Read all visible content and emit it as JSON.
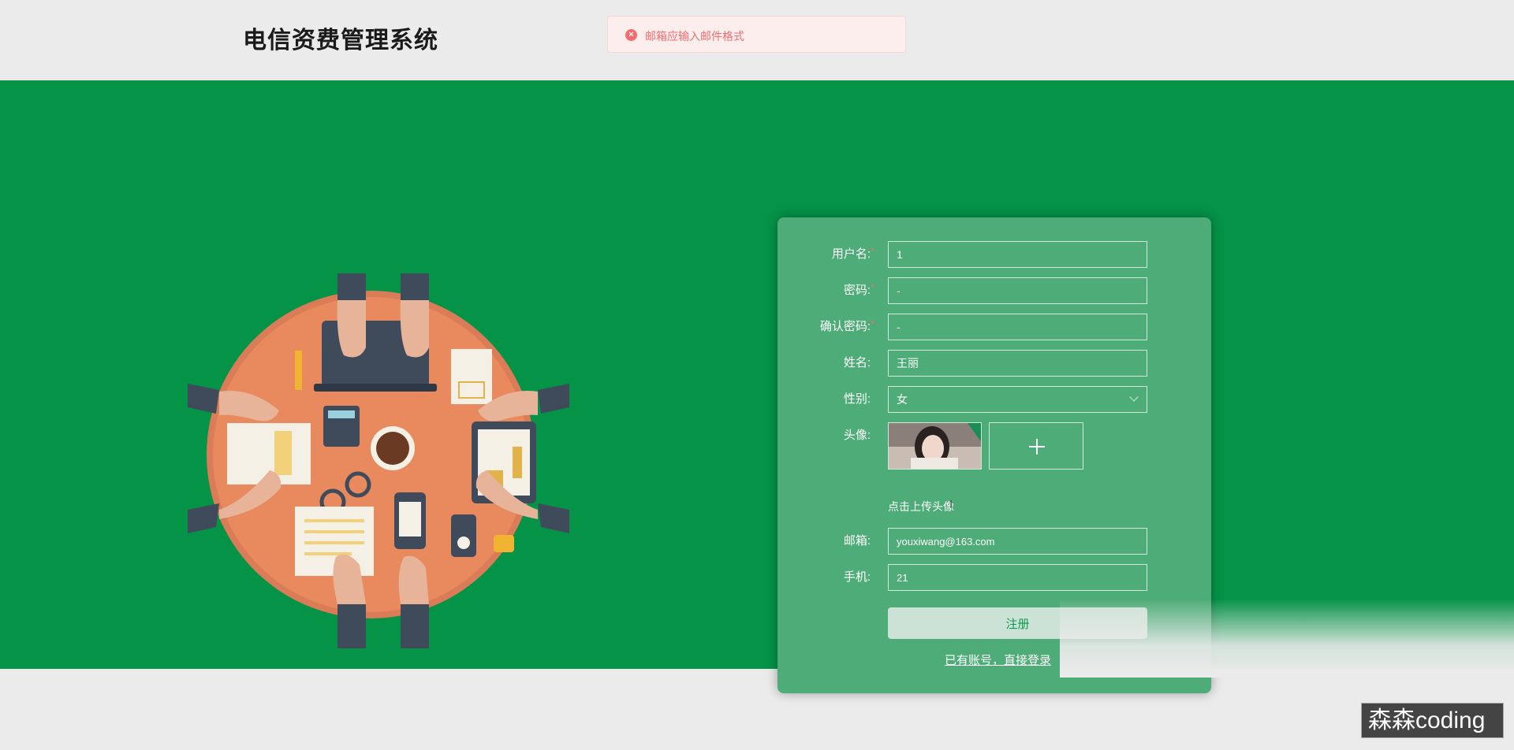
{
  "header": {
    "title": "电信资费管理系统"
  },
  "toast": {
    "icon": "error-circle-icon",
    "message": "邮箱应输入邮件格式",
    "color": "#f56c6c"
  },
  "colors": {
    "hero_green": "#059347",
    "card_green": "#4dac77",
    "button_bg": "#cde2d6",
    "button_text": "#0b9a4f"
  },
  "form": {
    "username": {
      "label": "用户名:",
      "value": "1",
      "required": true
    },
    "password": {
      "label": "密码:",
      "value": "-",
      "required": true
    },
    "confirm_password": {
      "label": "确认密码:",
      "value": "-",
      "required": true
    },
    "name": {
      "label": "姓名:",
      "value": "王丽"
    },
    "gender": {
      "label": "性别:",
      "value": "女",
      "icon": "chevron-down-icon"
    },
    "avatar": {
      "label": "头像:",
      "upload_icon": "plus-icon",
      "hint": "点击上传头像"
    },
    "email": {
      "label": "邮箱:",
      "value": "youxiwang@163.com"
    },
    "phone": {
      "label": "手机:",
      "value": "21"
    },
    "submit_label": "注册",
    "login_link": "已有账号，直接登录"
  },
  "watermark": {
    "text": "森森coding"
  }
}
